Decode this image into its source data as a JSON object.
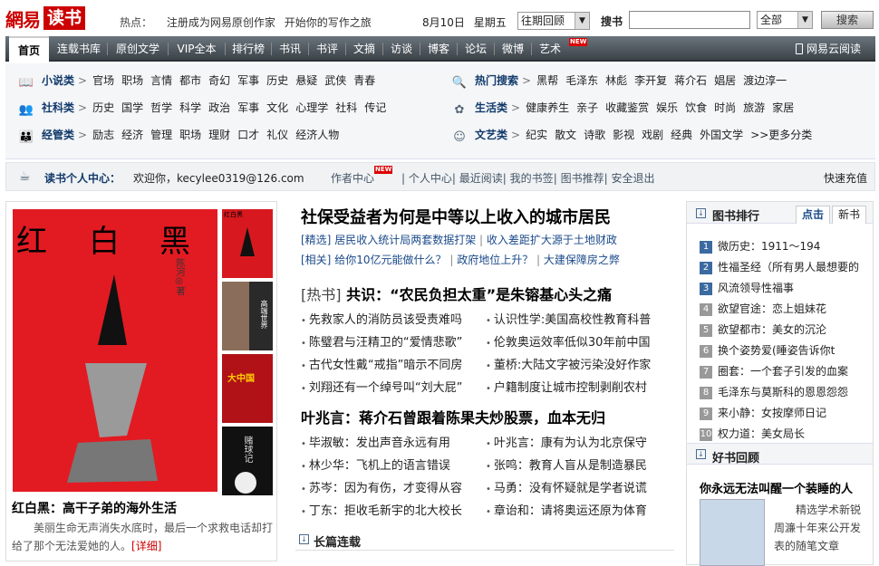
{
  "header": {
    "logo_text1": "網易",
    "logo_text2": "读书",
    "hot_label": "热点：",
    "hot_links": [
      "注册成为网易原创作家",
      "开始你的写作之旅"
    ],
    "date": "8月10日",
    "weekday": "星期五",
    "issue_select": "往期回顾",
    "search_label": "搜书",
    "search_value": "",
    "scope_select": "全部",
    "search_button": "搜索"
  },
  "nav": {
    "items": [
      "首页",
      "连载书库",
      "原创文学",
      "VIP全本",
      "排行榜",
      "书讯",
      "书评",
      "文摘",
      "访谈",
      "博客",
      "论坛",
      "微博",
      "艺术"
    ],
    "new_badge": "NEW",
    "cloud_read": "网易云阅读"
  },
  "categories": [
    {
      "title": "小说类",
      "icon": "book-icon",
      "items": [
        "官场",
        "职场",
        "言情",
        "都市",
        "奇幻",
        "军事",
        "历史",
        "悬疑",
        "武侠",
        "青春"
      ]
    },
    {
      "title": "社科类",
      "icon": "people-icon",
      "items": [
        "历史",
        "国学",
        "哲学",
        "科学",
        "政治",
        "军事",
        "文化",
        "心理学",
        "社科",
        "传记"
      ]
    },
    {
      "title": "经管类",
      "icon": "group-icon",
      "items": [
        "励志",
        "经济",
        "管理",
        "职场",
        "理财",
        "口才",
        "礼仪",
        "经济人物"
      ]
    },
    {
      "title": "热门搜索",
      "icon": "search-icon",
      "items": [
        "黑帮",
        "毛泽东",
        "林彪",
        "李开复",
        "蒋介石",
        "娼居",
        "渡边淳一"
      ]
    },
    {
      "title": "生活类",
      "icon": "flower-icon",
      "items": [
        "健康养生",
        "亲子",
        "收藏鉴赏",
        "娱乐",
        "饮食",
        "时尚",
        "旅游",
        "家居"
      ]
    },
    {
      "title": "文艺类",
      "icon": "mask-icon",
      "items": [
        "纪实",
        "散文",
        "诗歌",
        "影视",
        "戏剧",
        "经典",
        "外国文学",
        ">>更多分类"
      ]
    }
  ],
  "user_center": {
    "title": "读书个人中心：",
    "welcome": "欢迎你，kecylee0319@126.com",
    "links": [
      "作者中心",
      "个人中心",
      "最近阅读",
      "我的书签",
      "图书推荐",
      "安全退出"
    ],
    "charge": "快速充值"
  },
  "feature": {
    "cover_chars": [
      "红",
      "白",
      "黑"
    ],
    "cover_author": "陈河◎著",
    "title": "红白黑：高干子弟的海外生活",
    "desc": "美丽生命无声消失水底时，最后一个求救电话却打给了那个无法爱她的人。",
    "more": "[详细]",
    "thumbs": [
      "红白黑",
      "高端世界",
      "大中国",
      "赌球记"
    ]
  },
  "center": {
    "headline": "社保受益者为何是中等以上收入的城市居民",
    "sub1": {
      "tag": "[精选]",
      "a": "居民收入统计局两套数据打架",
      "b": "收入差距扩大源于土地财政"
    },
    "sub2": {
      "tag": "[相关]",
      "a": "给你10亿元能做什么？",
      "b": "政府地位上升？",
      "c": "大建保障房之弊"
    },
    "section1_prefix": "[热书]",
    "section1": "共识：“农民负担太重”是朱镕基心头之痛",
    "list1": [
      "先救家人的消防员该受责难吗",
      "认识性学:美国高校性教育科普",
      "陈璧君与汪精卫的“爱情悲歌”",
      "伦敦奥运效率低似30年前中国",
      "古代女性戴“戒指”暗示不同房",
      "董桥:大陆文字被污染没好作家",
      "刘翔还有一个绰号叫“刘大屁”",
      "户籍制度让城市控制剥削农村"
    ],
    "section2": "叶兆言：蒋介石曾跟着陈果夫炒股票，血本无归",
    "list2": [
      "毕淑敏：发出声音永远有用",
      "叶兆言：康有为认为北京保守",
      "林少华：飞机上的语言错误",
      "张鸣：教育人盲从是制造暴民",
      "苏岑：因为有伤，才变得从容",
      "马勇：没有怀疑就是学者说谎",
      "丁东：拒收毛新宇的北大校长",
      "章诒和：请将奥运还原为体育"
    ],
    "serial_title": "长篇连载"
  },
  "ranking": {
    "title": "图书排行",
    "tabs": [
      "点击",
      "新书"
    ],
    "items": [
      "微历史：1911～194",
      "性福圣经（所有男人最想要的",
      "风流领导性福事",
      "欲望官途：恋上姐妹花",
      "欲望都市：美女的沉沦",
      "换个姿势爱(睡姿告诉你t",
      "圈套：一个套子引发的血案",
      "毛泽东与莫斯科的恩恩怨怨",
      "来小静：女按摩师日记",
      "权力道：美女局长"
    ],
    "rank_colors": [
      "#3b6aa0",
      "#3b6aa0",
      "#3b6aa0",
      "#999999"
    ]
  },
  "good_books": {
    "title": "好书回顾",
    "book_title": "你永远无法叫醒一个装睡的人",
    "desc": "精选学术新锐周濂十年来公开发表的随笔文章"
  },
  "colors": {
    "brand_red": "#cc0000",
    "nav_dark": "#3c4349",
    "link_blue": "#1a4a8a"
  }
}
